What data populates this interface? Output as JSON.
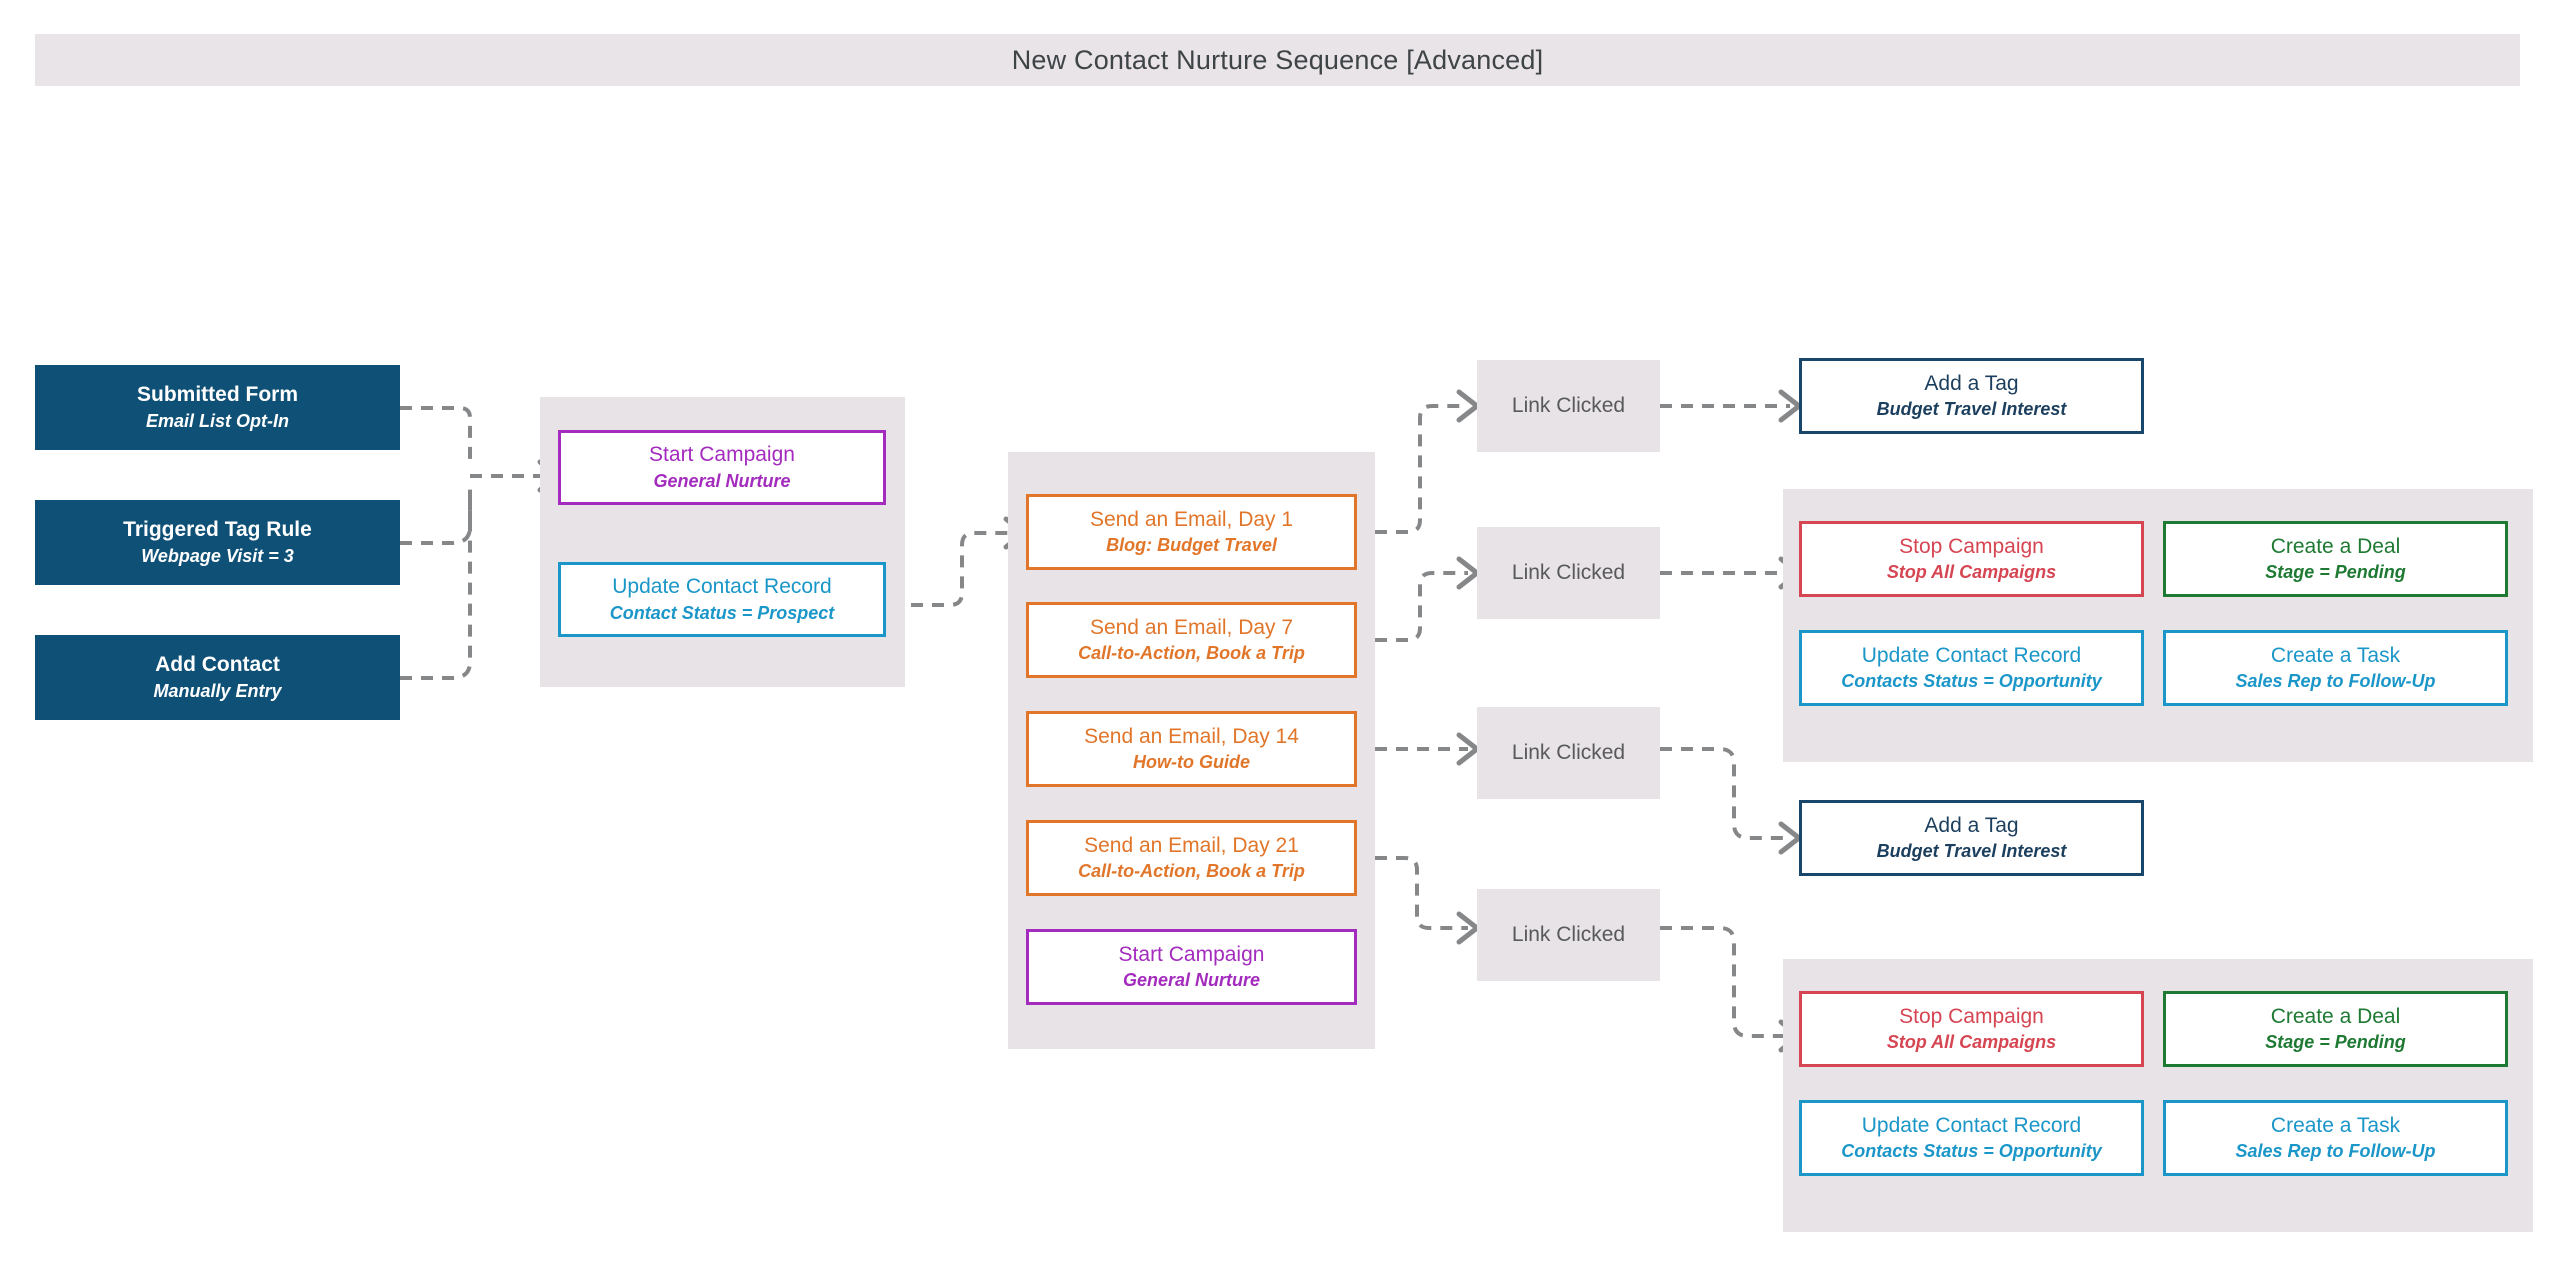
{
  "header": {
    "title": "New Contact Nurture Sequence [Advanced]"
  },
  "colors": {
    "page_background": "#ffffff",
    "panel_background": "#e8e3e7",
    "titlebar_background": "#e9e4e8",
    "trigger_fill": "#0f5077",
    "purple": "#a32bbd",
    "cyan": "#1b96c8",
    "orange": "#e1762a",
    "navy": "#19466b",
    "red": "#d64552",
    "green": "#1e7a33",
    "connector": "#868789",
    "chip_text": "#58595b"
  },
  "triggers": [
    {
      "title": "Submitted Form",
      "sub": "Email List Opt-In"
    },
    {
      "title": "Triggered Tag Rule",
      "sub": "Webpage Visit = 3"
    },
    {
      "title": "Add Contact",
      "sub": "Manually Entry"
    }
  ],
  "entry_group": {
    "nodes": [
      {
        "title": "Start Campaign",
        "sub": "General Nurture"
      },
      {
        "title": "Update Contact Record",
        "sub": "Contact Status = Prospect"
      }
    ]
  },
  "sequence_group": {
    "nodes": [
      {
        "title": "Send an Email, Day 1",
        "sub": "Blog: Budget Travel"
      },
      {
        "title": "Send an Email, Day 7",
        "sub": "Call-to-Action, Book a Trip"
      },
      {
        "title": "Send an Email, Day 14",
        "sub": "How-to Guide"
      },
      {
        "title": "Send an Email, Day 21",
        "sub": "Call-to-Action, Book a Trip"
      },
      {
        "title": "Start Campaign",
        "sub": "General Nurture"
      }
    ]
  },
  "conditions": [
    {
      "label": "Link Clicked"
    },
    {
      "label": "Link Clicked"
    },
    {
      "label": "Link Clicked"
    },
    {
      "label": "Link Clicked"
    }
  ],
  "tag_actions": [
    {
      "title": "Add a Tag",
      "sub": "Budget Travel Interest"
    },
    {
      "title": "Add a Tag",
      "sub": "Budget Travel Interest"
    }
  ],
  "outcome_group_top": {
    "nodes": [
      {
        "title": "Stop Campaign",
        "sub": "Stop All Campaigns"
      },
      {
        "title": "Create a Deal",
        "sub": "Stage = Pending"
      },
      {
        "title": "Update Contact Record",
        "sub": "Contacts Status = Opportunity"
      },
      {
        "title": "Create a Task",
        "sub": "Sales Rep to Follow-Up"
      }
    ]
  },
  "outcome_group_bottom": {
    "nodes": [
      {
        "title": "Stop Campaign",
        "sub": "Stop All Campaigns"
      },
      {
        "title": "Create a Deal",
        "sub": "Stage = Pending"
      },
      {
        "title": "Update Contact Record",
        "sub": "Contacts Status = Opportunity"
      },
      {
        "title": "Create a Task",
        "sub": "Sales Rep to Follow-Up"
      }
    ]
  }
}
